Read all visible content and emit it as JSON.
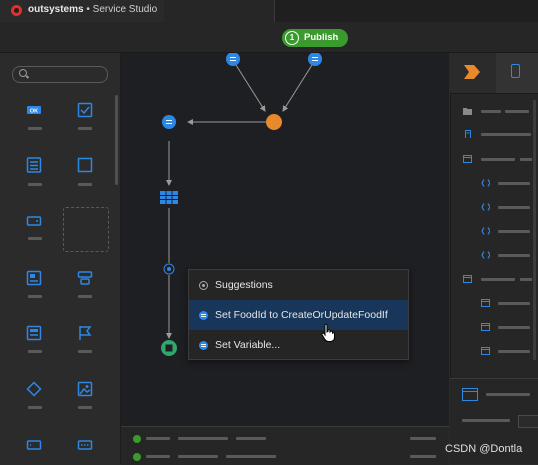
{
  "app": {
    "brand": "outsystems",
    "product": "Service Studio",
    "separator": "•"
  },
  "toolbar": {
    "publish_number": "1",
    "publish_label": "Publish"
  },
  "context_menu": {
    "items": [
      {
        "label": "Suggestions",
        "icon": "suggestions-icon"
      },
      {
        "label": "Set FoodId to CreateOrUpdateFoodIf",
        "icon": "assign-icon",
        "highlighted": true
      },
      {
        "label": "Set Variable...",
        "icon": "assign-icon"
      }
    ]
  },
  "watermark": "CSDN @Dontla",
  "colors": {
    "accent": "#2d88e5",
    "publish_green": "#3a9a2e",
    "start_node": "#e8892b",
    "end_node": "#2ea86b",
    "canvas": "#1e1f22",
    "highlight": "#17365a"
  },
  "toolbox": {
    "icons": [
      "button-icon",
      "checkbox-icon",
      "form-icon",
      "container-icon",
      "input-icon",
      "placeholder",
      "text-icon",
      "label-icon",
      "list-icon",
      "flag-icon",
      "if-icon",
      "image-icon",
      "link-icon",
      "dots-icon"
    ]
  }
}
